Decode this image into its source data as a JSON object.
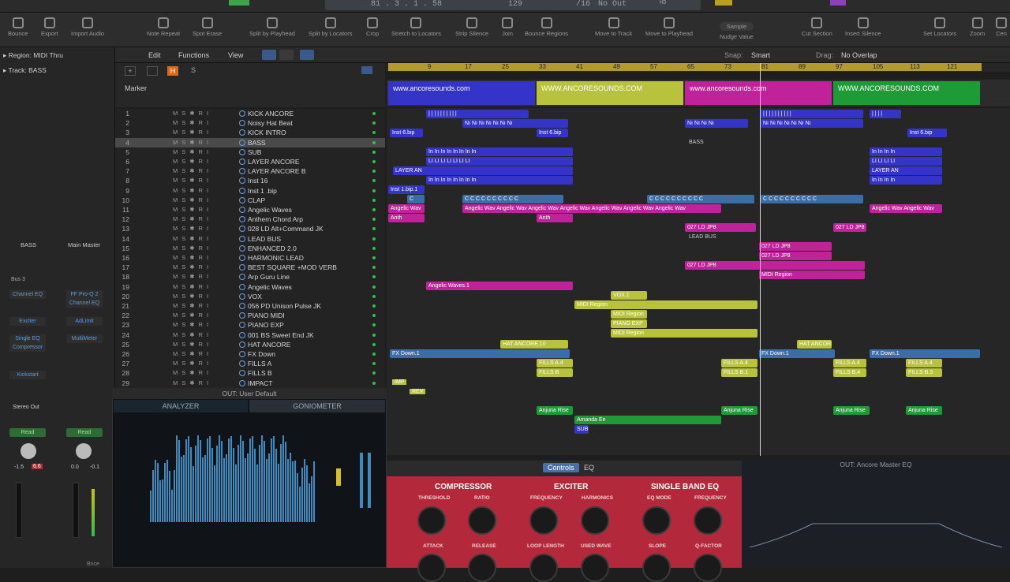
{
  "transport": {
    "position": "81 . 3 . 1 .  58",
    "tempo": "129",
    "signature": "/16",
    "output": "No Out",
    "hd": "HD"
  },
  "toolbar": {
    "items": [
      "Bounce",
      "Export",
      "Import Audio",
      "Note Repeat",
      "Spot Erase",
      "Split by Playhead",
      "Split by Locators",
      "Crop",
      "Stretch to Locators",
      "Strip Silence",
      "Join",
      "Bounce Regions",
      "Move to Track",
      "Move to Playhead",
      "Sample",
      "Nudge Value",
      "Cut Section",
      "Insert Silence",
      "Set Locators",
      "Zoom",
      "Cen"
    ]
  },
  "inspector": {
    "region": "Region: MIDI Thru",
    "track": "Track:  BASS",
    "strip1": "BASS",
    "strip2": "Main Master",
    "bus": "Bus 3",
    "eq": "Channel EQ",
    "ffpro": "FF Pro-Q 2",
    "chaneq2": "Channel EQ",
    "exciter": "Exciter",
    "adlimit": "AdLimit",
    "singleeq": "Single EQ Compressor",
    "multimeter": "MultiMeter",
    "kickstart": "Kickstart",
    "stereo": "Stereo Out",
    "read1": "Read",
    "read2": "Read",
    "val1": "-1.5",
    "val2": "6.6",
    "val3": "0.0",
    "val4": "-0.1",
    "bnce": "Bnce"
  },
  "localbar": {
    "edit": "Edit",
    "functions": "Functions",
    "view": "View",
    "snap_label": "Snap:",
    "snap": "Smart",
    "drag_label": "Drag:",
    "drag": "No Overlap",
    "marker": "Marker"
  },
  "ruler": [
    "9",
    "17",
    "25",
    "33",
    "41",
    "49",
    "57",
    "65",
    "73",
    "81",
    "89",
    "97",
    "105",
    "113",
    "121"
  ],
  "markers": [
    "www.ancoresounds.com",
    "WWW.ANCORESOUNDS.COM",
    "www.ancoresounds.com",
    "WWW.ANCORESOUNDS.COM"
  ],
  "tracks": [
    {
      "n": "1",
      "name": "KICK ANCORE"
    },
    {
      "n": "2",
      "name": "Noisy Hat Beat"
    },
    {
      "n": "3",
      "name": "KICK INTRO"
    },
    {
      "n": "4",
      "name": "BASS"
    },
    {
      "n": "5",
      "name": "SUB"
    },
    {
      "n": "6",
      "name": "LAYER ANCORE"
    },
    {
      "n": "7",
      "name": "LAYER ANCORE B"
    },
    {
      "n": "8",
      "name": "Inst 16"
    },
    {
      "n": "9",
      "name": "Inst 1 .bip"
    },
    {
      "n": "10",
      "name": "CLAP"
    },
    {
      "n": "11",
      "name": "Angelic Waves"
    },
    {
      "n": "12",
      "name": "Anthem Chord Arp"
    },
    {
      "n": "13",
      "name": "028 LD Alt+Command JK"
    },
    {
      "n": "14",
      "name": "LEAD BUS"
    },
    {
      "n": "15",
      "name": "ENHANCED 2.0"
    },
    {
      "n": "16",
      "name": "HARMONIC LEAD"
    },
    {
      "n": "17",
      "name": "BEST SQUARE +MOD VERB"
    },
    {
      "n": "18",
      "name": "Arp Guru Line"
    },
    {
      "n": "19",
      "name": "Angelic Waves"
    },
    {
      "n": "20",
      "name": "VOX"
    },
    {
      "n": "21",
      "name": "056 PD Unison Pulse JK"
    },
    {
      "n": "22",
      "name": "PIANO MIDI"
    },
    {
      "n": "23",
      "name": "PIANO EXP"
    },
    {
      "n": "24",
      "name": "001 BS Sweet End JK"
    },
    {
      "n": "25",
      "name": "HAT ANCORE"
    },
    {
      "n": "26",
      "name": "FX Down"
    },
    {
      "n": "27",
      "name": "FILLS A"
    },
    {
      "n": "28",
      "name": "FILLS B"
    },
    {
      "n": "29",
      "name": "IMPACT"
    }
  ],
  "regions": {
    "inst6": "Inst 6.bip",
    "bass": "BASS",
    "instbip": "Inst 1.bip.1",
    "layer": "LAYER AN",
    "angelic": "Angelic Wav",
    "anthem": "Anth",
    "ld": "027 LD JP8",
    "leadbus": "LEAD BUS",
    "angelic19": "Angelic Waves.1",
    "vox": "VOX.1",
    "midi": "MIDI Region",
    "piano": "PIANO EXP",
    "hat": "HAT ANCORE.10",
    "fx": "FX Down.1",
    "fills": "FILLS A.4",
    "impact": "IMP",
    "rev": "REV",
    "anjuna": "Anjuna Rise",
    "amanda": "Amanda Ee",
    "sub": "SUB"
  },
  "analyzer": {
    "title": "OUT: User Default",
    "tab1": "ANALYZER",
    "tab2": "GONIOMETER"
  },
  "plugin": {
    "controls": "Controls",
    "eq": "EQ",
    "comp": "COMPRESSOR",
    "exciter": "EXCITER",
    "sbeq": "SINGLE BAND EQ",
    "threshold": "THRESHOLD",
    "ratio": "RATIO",
    "frequency": "FREQUENCY",
    "harmonics": "HARMONICS",
    "eqmode": "EQ MODE",
    "frequency2": "FREQUENCY",
    "attack": "ATTACK",
    "release": "RELEASE",
    "looplen": "LOOP LENGTH",
    "usedwave": "USED WAVE",
    "slope": "SLOPE",
    "qfactor": "Q-FACTOR",
    "eqtitle": "OUT: Ancore Master EQ"
  },
  "colors": {
    "blue": "#3434c8",
    "yellow": "#b8c23c",
    "magenta": "#c0229a",
    "green": "#1e9a36",
    "red": "#b3283a"
  }
}
